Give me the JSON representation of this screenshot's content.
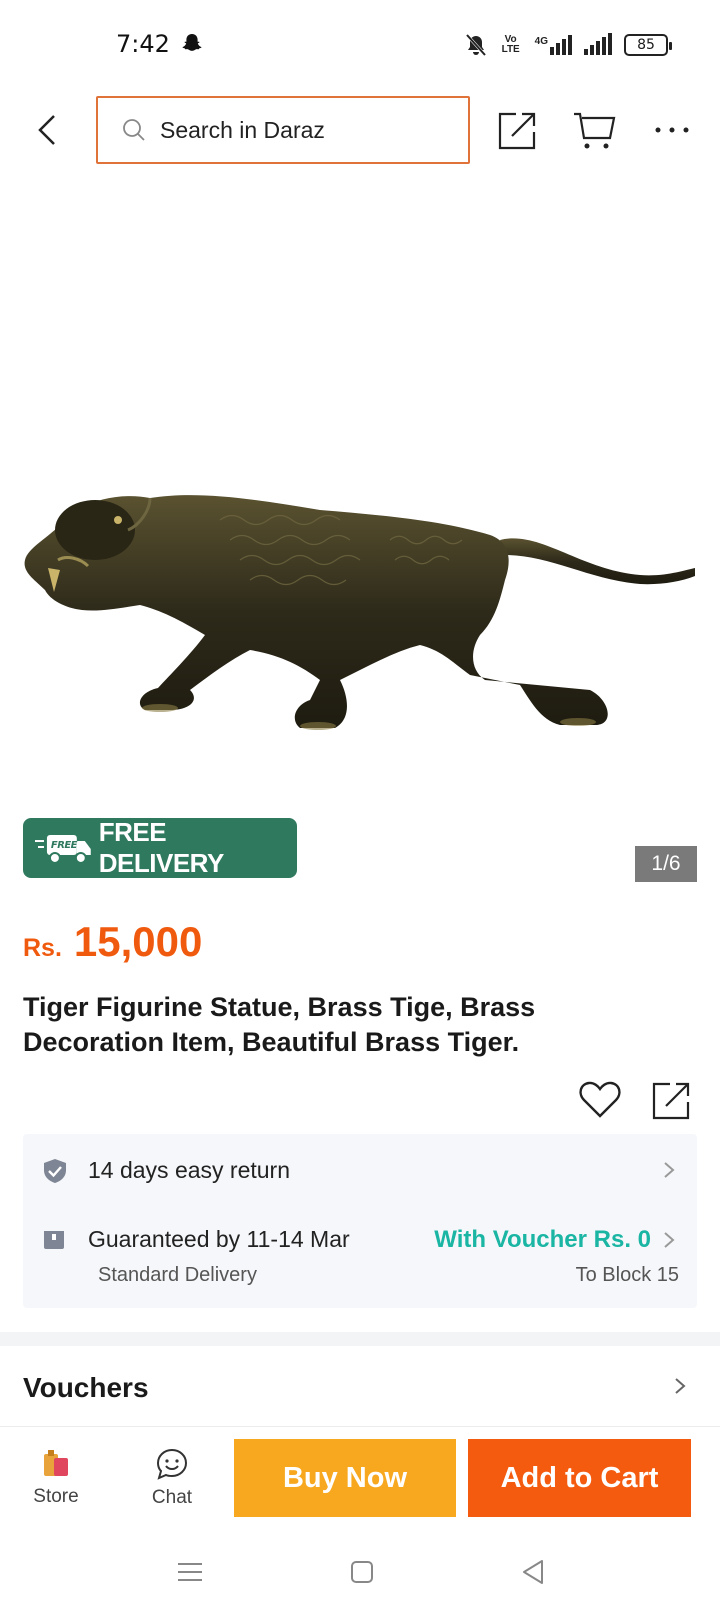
{
  "status_bar": {
    "time": "7:42",
    "battery": "85",
    "volte_label": "Vo LTE",
    "network_label": "4G",
    "icons": [
      "snapchat-icon",
      "mute-icon",
      "volte-icon",
      "signal-4g-icon",
      "signal-icon",
      "battery-icon"
    ]
  },
  "header": {
    "search_placeholder": "Search in Daraz",
    "icons": [
      "back-icon",
      "search-icon",
      "share-icon",
      "cart-icon",
      "more-icon"
    ],
    "accent_color": "#e0733a"
  },
  "product": {
    "image_alt": "Brass tiger figurine",
    "free_delivery_small": "FREE",
    "free_delivery_label": "FREE DELIVERY",
    "image_counter": "1/6",
    "price_currency": "Rs.",
    "price_value": "15,000",
    "title": "Tiger Figurine Statue, Brass Tige, Brass Decoration Item, Beautiful Brass Tiger.",
    "price_color": "#f05a0e"
  },
  "service": {
    "return_text": "14 days easy return",
    "delivery_text": "Guaranteed by 11-14 Mar",
    "delivery_sub": "Standard Delivery",
    "voucher_text": "With Voucher Rs. 0",
    "location_text": "To Block 15",
    "voucher_color": "#1bb5a4"
  },
  "vouchers": {
    "label": "Vouchers"
  },
  "bottom_bar": {
    "store_label": "Store",
    "chat_label": "Chat",
    "buy_now_label": "Buy Now",
    "add_to_cart_label": "Add to Cart",
    "buy_color": "#f8a81f",
    "cart_color": "#f55b0e"
  },
  "nav_bar": {
    "icons": [
      "menu-icon",
      "home-icon",
      "back-nav-icon"
    ]
  }
}
